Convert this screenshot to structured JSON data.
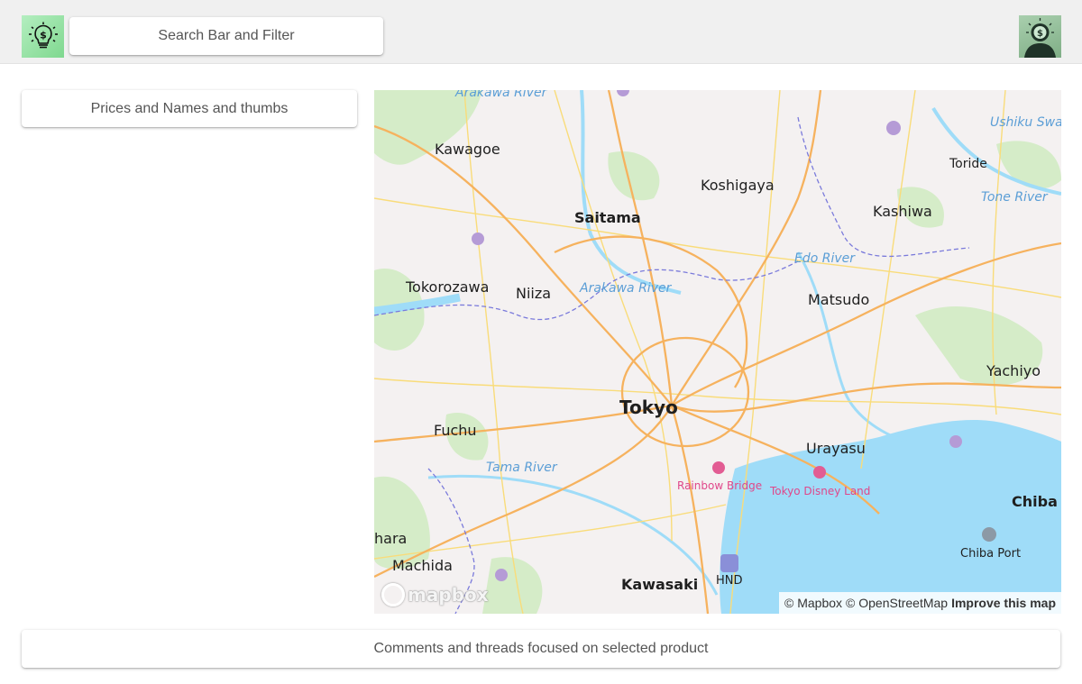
{
  "header": {
    "logo_icon": "lightbulb-dollar-icon",
    "search_label": "Search Bar and Filter",
    "avatar_icon": "user-avatar-icon"
  },
  "panels": {
    "listing_label": "Prices and Names and thumbs",
    "comments_label": "Comments and threads focused on selected product"
  },
  "map": {
    "places": {
      "tokyo": "Tokyo",
      "saitama": "Saitama",
      "kawagoe": "Kawagoe",
      "koshigaya": "Koshigaya",
      "toride": "Toride",
      "kashiwa": "Kashiwa",
      "tokorozawa": "Tokorozawa",
      "niiza": "Niiza",
      "matsudo": "Matsudo",
      "yachiyo": "Yachiyo",
      "fuchu": "Fuchu",
      "urayasu": "Urayasu",
      "chiba": "Chiba",
      "machida": "Machida",
      "kawasaki": "Kawasaki",
      "hara": "hara",
      "hnd": "HND",
      "chiba_port": "Chiba Port"
    },
    "water": {
      "arakawa_top": "Arakawa River",
      "arakawa_mid": "Arakawa River",
      "edo": "Edo River",
      "tone": "Tone River",
      "tama": "Tama River",
      "ushiku": "Ushiku Swa"
    },
    "pois": {
      "rainbow_bridge": "Rainbow Bridge",
      "tokyo_disney_land": "Tokyo Disney Land"
    },
    "logo_text": "mapbox",
    "attribution": {
      "mapbox": "© Mapbox",
      "osm": "© OpenStreetMap",
      "improve": "Improve this map"
    },
    "colors": {
      "water": "#9fdcf8",
      "land": "#f4f1f1",
      "park": "#d5ecc8",
      "major_road": "#f6b25e",
      "minor_road": "#f9dc7a",
      "boundary": "#7a7adb"
    }
  }
}
